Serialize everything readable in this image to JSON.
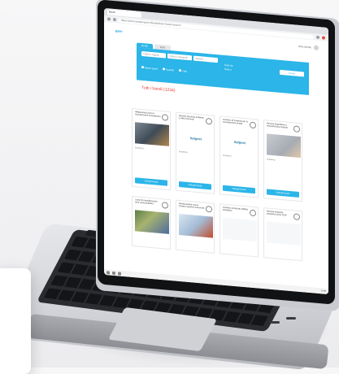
{
  "browser": {
    "tab_title": "Bandi",
    "url": "https://www.example-gare.it/bandi/index?action=search"
  },
  "site": {
    "logo": "gare",
    "user_label": "Area Utente",
    "tabs": [
      "Bandi",
      "Esiti"
    ]
  },
  "search": {
    "field1": "Tutte le regioni",
    "field2": "Tutte le categorie",
    "field3": "Importo",
    "radio1": "Bandi aperti",
    "radio2": "Scaduti",
    "radio3": "Tutti",
    "side_text1": "Data da",
    "side_text2": "Data a",
    "button": "Cerca"
  },
  "section_title": "Tutti i bandi (1234)",
  "cards": [
    {
      "title": "Affidamento lavori di manutenzione straordinaria",
      "meta": "Scadenza",
      "button": "Dettagli bando",
      "img": "photo"
    },
    {
      "title": "Servizio di pulizia ambienti e uffici comunali",
      "meta": "Scadenza",
      "button": "Dettagli bando",
      "img": "logo",
      "logo_text": "Italgest"
    },
    {
      "title": "Fornitura di materiali per la manutenzione strade",
      "meta": "Scadenza",
      "button": "Dettagli bando",
      "img": "logo",
      "logo_text": "Italgest"
    },
    {
      "title": "Servizio di gestione e manutenzione impianti",
      "meta": "Scadenza",
      "button": "Dettagli bando",
      "img": "hand"
    }
  ],
  "cards_row2": [
    {
      "title": "Lavori di riqualificazione area verde pubblica",
      "img": "site"
    },
    {
      "title": "Realizzazione nuova struttura sportiva comunale",
      "img": "crane"
    },
    {
      "title": "Fornitura arredi per edificio scolastico",
      "img": "blank"
    },
    {
      "title": "Servizio trasporto scolastico anno 2019",
      "img": "blank"
    }
  ],
  "taskbar": {
    "clock": "10:45"
  }
}
